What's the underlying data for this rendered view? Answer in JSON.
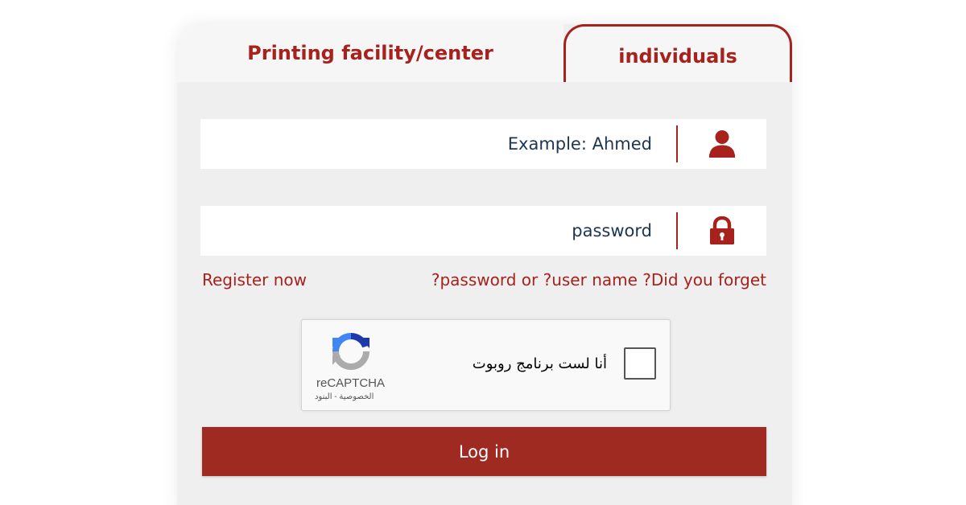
{
  "tabs": {
    "printing_facility": "Printing facility/center",
    "individuals": "individuals"
  },
  "username": {
    "placeholder": "Example: Ahmed",
    "icon": "user-icon"
  },
  "password": {
    "placeholder": "password",
    "icon": "lock-icon"
  },
  "links": {
    "register": "Register now",
    "forgot": "?password or ?user name ?Did you forget"
  },
  "captcha": {
    "label": "أنا لست برنامج روبوت",
    "brand": "reCAPTCHA",
    "terms": "الخصوصية - البنود",
    "icon": "recaptcha-icon"
  },
  "login": {
    "label": "Log in"
  },
  "colors": {
    "accent": "#a7221c",
    "button": "#9e2a22",
    "input_text": "#1e3550",
    "card_bg": "#efefef"
  }
}
